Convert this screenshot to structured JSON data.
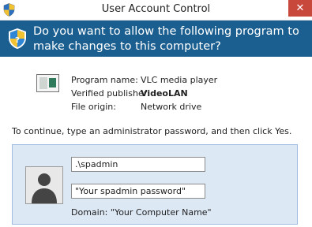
{
  "window": {
    "title": "User Account Control",
    "close_glyph": "✕"
  },
  "header": {
    "question": "Do you want to allow the following program to make changes to this computer?",
    "icon": "shield-icon"
  },
  "program": {
    "icon": "application-icon",
    "name_label": "Program name:",
    "name_value": "VLC media player",
    "publisher_label": "Verified publisher:",
    "publisher_value": "VideoLAN",
    "origin_label": "File origin:",
    "origin_value": "Network drive"
  },
  "instruction": "To continue, type an administrator password, and then click Yes.",
  "credentials": {
    "avatar_icon": "user-avatar-icon",
    "username": ".\\spadmin",
    "password": "\"Your spadmin password\"",
    "domain": "Domain: \"Your Computer Name\""
  },
  "colors": {
    "header_bg": "#1b5f91",
    "close_bg": "#c9483c",
    "panel_bg": "#dde8f5"
  }
}
